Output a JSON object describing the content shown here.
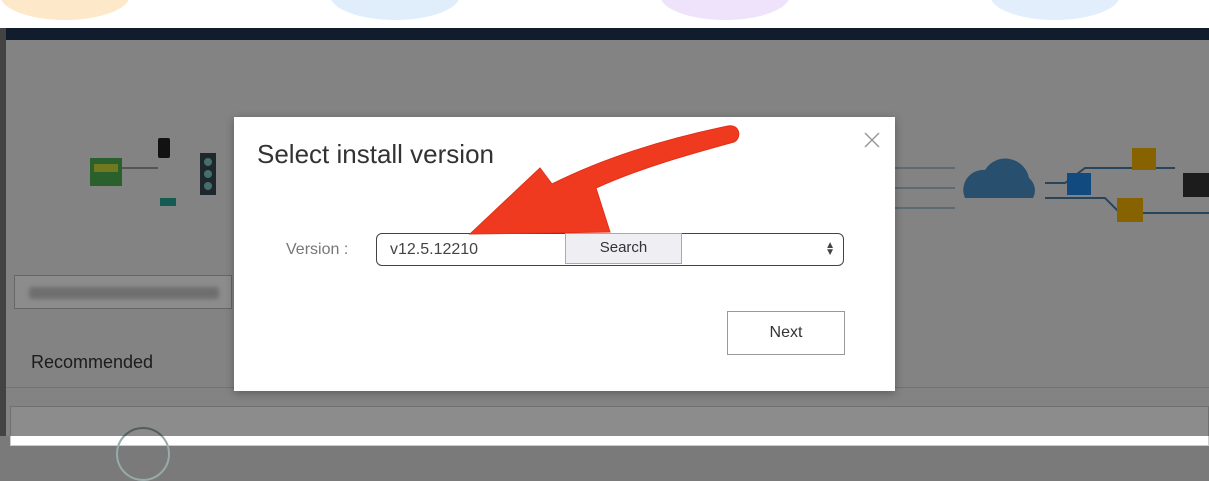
{
  "background": {
    "section_title": "Recommended"
  },
  "dialog": {
    "title": "Select install version",
    "version_label": "Version :",
    "version_value": "v12.5.12210",
    "search_label": "Search",
    "next_label": "Next"
  },
  "icons": [
    "close-icon",
    "select-spinner-icon",
    "red-arrow-annotation"
  ],
  "colors": {
    "topbar": "#1f3552",
    "arrow": "#f03a1f"
  }
}
